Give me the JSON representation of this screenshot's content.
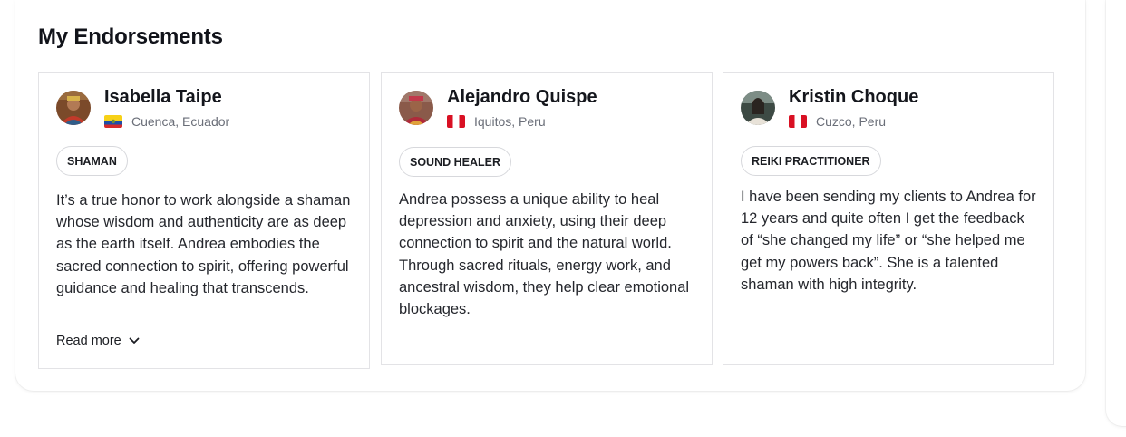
{
  "section": {
    "title": "My Endorsements"
  },
  "endorsements": [
    {
      "name": "Isabella Taipe",
      "location": "Cuenca, Ecuador",
      "flag": "ecuador-flag",
      "badge": "SHAMAN",
      "quote": "It’s a true honor to work alongside a shaman whose wisdom and authenticity are as deep as the earth itself. Andrea embodies the sacred connection to spirit, offering powerful guidance and healing that transcends.",
      "read_more": "Read more"
    },
    {
      "name": "Alejandro Quispe",
      "location": "Iquitos, Peru",
      "flag": "peru-flag",
      "badge": "SOUND HEALER",
      "quote": "Andrea possess a unique ability to heal depression and anxiety, using their deep connection to spirit and the natural world. Through sacred rituals, energy work, and ancestral wisdom, they help clear emotional blockages."
    },
    {
      "name": "Kristin Choque",
      "location": "Cuzco, Peru",
      "flag": "peru-flag",
      "badge": "REIKI PRACTITIONER",
      "quote": "I have been sending my clients to Andrea for 12 years and quite often I get the feedback of “she changed my life” or “she helped me get my powers back”. She is a talented shaman with high integrity."
    }
  ]
}
